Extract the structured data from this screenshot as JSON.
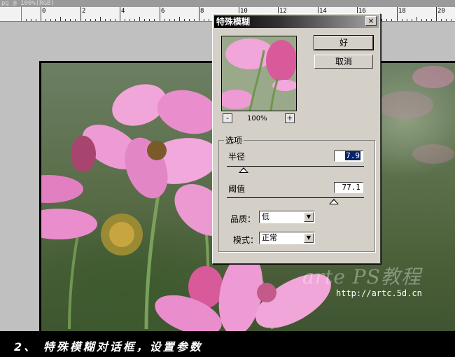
{
  "document": {
    "title": "pg @ 100%(RGB)"
  },
  "ruler": {
    "labels": [
      "0",
      "2",
      "4",
      "6",
      "8",
      "10",
      "12",
      "14",
      "16",
      "18",
      "20"
    ]
  },
  "dialog": {
    "title": "特殊模糊",
    "close": "×",
    "ok_label": "好",
    "cancel_label": "取消",
    "zoom_out": "-",
    "zoom_in": "+",
    "zoom_level": "100%",
    "options_group": "选项",
    "radius": {
      "label": "半径",
      "value": "7.9",
      "slider": 0.12
    },
    "threshold": {
      "label": "阈值",
      "value": "77.1",
      "slider": 0.78
    },
    "quality": {
      "label": "品质：",
      "value": "低"
    },
    "mode": {
      "label": "模式：",
      "value": "正常"
    }
  },
  "watermark": {
    "brand": "arte PS教程",
    "url": "http://artc.5d.cn"
  },
  "caption": "2、 特殊模糊对话框，设置参数"
}
